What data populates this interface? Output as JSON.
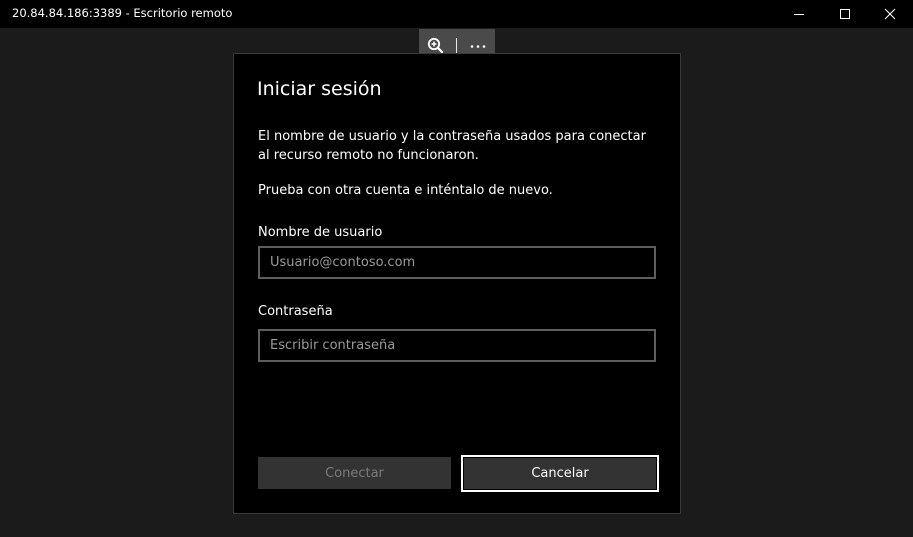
{
  "window": {
    "title": "20.84.84.186:3389 - Escritorio remoto",
    "controls": {
      "minimize_icon": "minimize-icon",
      "maximize_icon": "maximize-icon",
      "close_icon": "close-icon"
    }
  },
  "toolbar": {
    "zoom_icon": "zoom-in-icon",
    "more_icon": "more-options-icon"
  },
  "dialog": {
    "heading": "Iniciar sesión",
    "message_line": "El nombre de usuario y la contraseña usados para conectar al recurso remoto no funcionaron.",
    "retry_line": "Prueba con otra cuenta e inténtalo de nuevo.",
    "username": {
      "label": "Nombre de usuario",
      "placeholder": "Usuario@contoso.com",
      "value": ""
    },
    "password": {
      "label": "Contraseña",
      "placeholder": "Escribir contraseña",
      "value": ""
    },
    "connect_label": "Conectar",
    "cancel_label": "Cancelar"
  },
  "colors": {
    "background": "#1b1b1b",
    "titlebar": "#000000",
    "dialog_bg": "#000000",
    "toolbar_bg": "#4a4a4a",
    "button_bg": "#333333",
    "disabled_text": "#7a7a7a"
  }
}
